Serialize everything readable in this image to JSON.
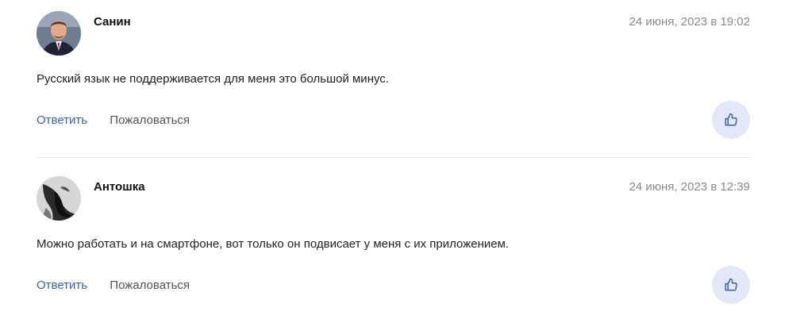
{
  "comments": [
    {
      "author": "Санин",
      "date": "24 июня, 2023 в 19:02",
      "text": "Русский язык не поддерживается для меня это большой минус.",
      "reply_label": "Ответить",
      "report_label": "Пожаловаться",
      "avatar_icon": "user-avatar-photo"
    },
    {
      "author": "Антошка",
      "date": "24 июня, 2023 в 12:39",
      "text": "Можно работать и на смартфоне, вот только он подвисает у меня с их приложением.",
      "reply_label": "Ответить",
      "report_label": "Пожаловаться",
      "avatar_icon": "user-avatar-photo"
    }
  ],
  "icons": {
    "like": "thumbs-up-icon"
  },
  "colors": {
    "reply_link": "#3e63b0",
    "like_bg": "#e3e8f9",
    "date": "#8a8a8a",
    "divider": "#e4e6ea"
  }
}
